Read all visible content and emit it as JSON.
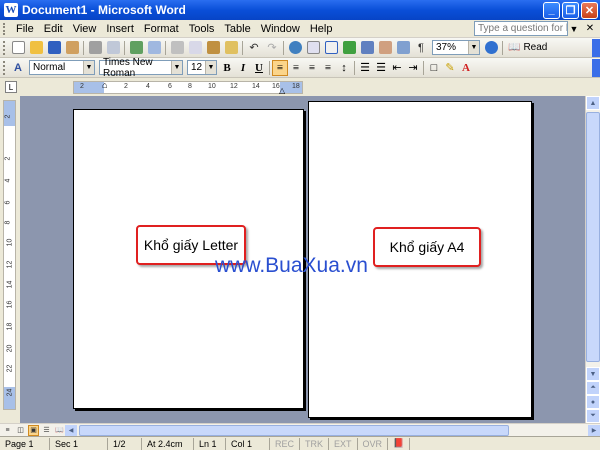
{
  "window": {
    "title": "Document1 - Microsoft Word",
    "app_icon_letter": "W",
    "minimize": "_",
    "maximize": "❐",
    "close": "✕"
  },
  "menubar": {
    "items": [
      "File",
      "Edit",
      "View",
      "Insert",
      "Format",
      "Tools",
      "Table",
      "Window",
      "Help"
    ],
    "help_placeholder": "Type a question for help",
    "help_arrow": "▼",
    "doc_close": "✕"
  },
  "standard_toolbar": {
    "zoom": "37%",
    "read_label": "Read"
  },
  "formatting_toolbar": {
    "style": "Normal",
    "font": "Times New Roman",
    "size": "12",
    "bold": "B",
    "italic": "I",
    "underline": "U"
  },
  "hruler": {
    "ticks": [
      "2",
      "2",
      "4",
      "6",
      "8",
      "10",
      "12",
      "14",
      "16",
      "18"
    ]
  },
  "vruler": {
    "ticks": [
      "2",
      "2",
      "4",
      "6",
      "8",
      "10",
      "12",
      "14",
      "16",
      "18",
      "20",
      "22",
      "24"
    ]
  },
  "document": {
    "letter_label": "Khổ giấy Letter",
    "a4_label": "Khổ giấy A4",
    "watermark": "www.BuaXua.vn"
  },
  "statusbar": {
    "page": "Page 1",
    "section": "Sec 1",
    "page_of": "1/2",
    "at": "At 2.4cm",
    "line": "Ln 1",
    "col": "Col 1",
    "rec": "REC",
    "trk": "TRK",
    "ext": "EXT",
    "ovr": "OVR"
  },
  "colors": {
    "titlebar": "#0a4fd8",
    "callout_border": "#e02020",
    "watermark": "#2a4fd0",
    "doc_background": "#8c96ae"
  }
}
